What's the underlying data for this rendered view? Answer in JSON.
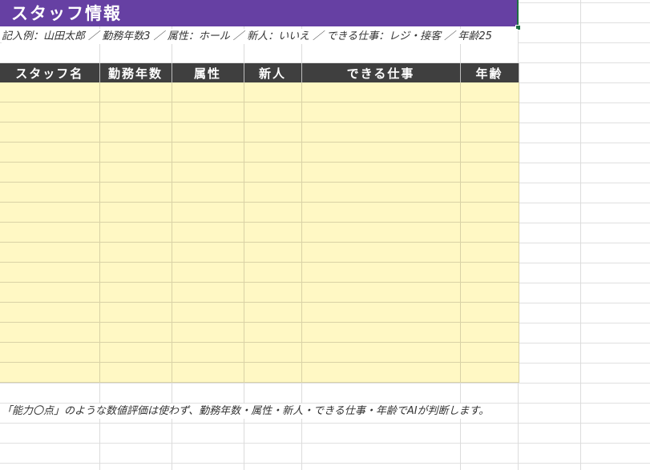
{
  "sheet": {
    "title": "スタッフ情報",
    "example_note": "記入例：山田太郎 ／ 勤務年数3 ／ 属性：ホール ／ 新人：いいえ ／ できる仕事：レジ・接客 ／ 年齢25",
    "footer_note": "「能力〇点」のような数値評価は使わず、勤務年数・属性・新人・できる仕事・年齢でAIが判断します。"
  },
  "table": {
    "columns": [
      "スタッフ名",
      "勤務年数",
      "属性",
      "新人",
      "できる仕事",
      "年齢"
    ],
    "empty_rows": 15
  },
  "colors": {
    "title_bg": "#6640a3",
    "header_bg": "#3f3f3f",
    "cell_bg": "#fff8c4"
  }
}
